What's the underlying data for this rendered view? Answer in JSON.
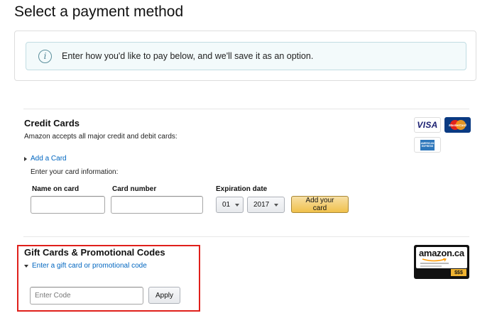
{
  "page": {
    "title": "Select a payment method"
  },
  "info": {
    "text": "Enter how you'd like to pay below, and we'll save it as an option.",
    "icon": "info-icon"
  },
  "credit": {
    "title": "Credit Cards",
    "subtitle": "Amazon accepts all major credit and debit cards:",
    "add_link": "Add a Card",
    "instruction": "Enter your card information:",
    "name_label": "Name on card",
    "name_value": "",
    "number_label": "Card number",
    "number_value": "",
    "exp_label": "Expiration date",
    "month": "01",
    "year": "2017",
    "submit": "Add your card",
    "logos": {
      "visa": "VISA",
      "mastercard": "MasterCard",
      "amex": "AMERICAN EXPRESS"
    }
  },
  "gift": {
    "title": "Gift Cards & Promotional Codes",
    "link": "Enter a gift card or promotional code",
    "placeholder": "Enter Code",
    "apply": "Apply",
    "card_logo": "amazon.ca",
    "card_amount": "$$$"
  },
  "colors": {
    "link": "#0066c0",
    "highlight": "#e0201b",
    "button_yellow": "#f0c14b",
    "info_bg": "#f3fafb"
  }
}
